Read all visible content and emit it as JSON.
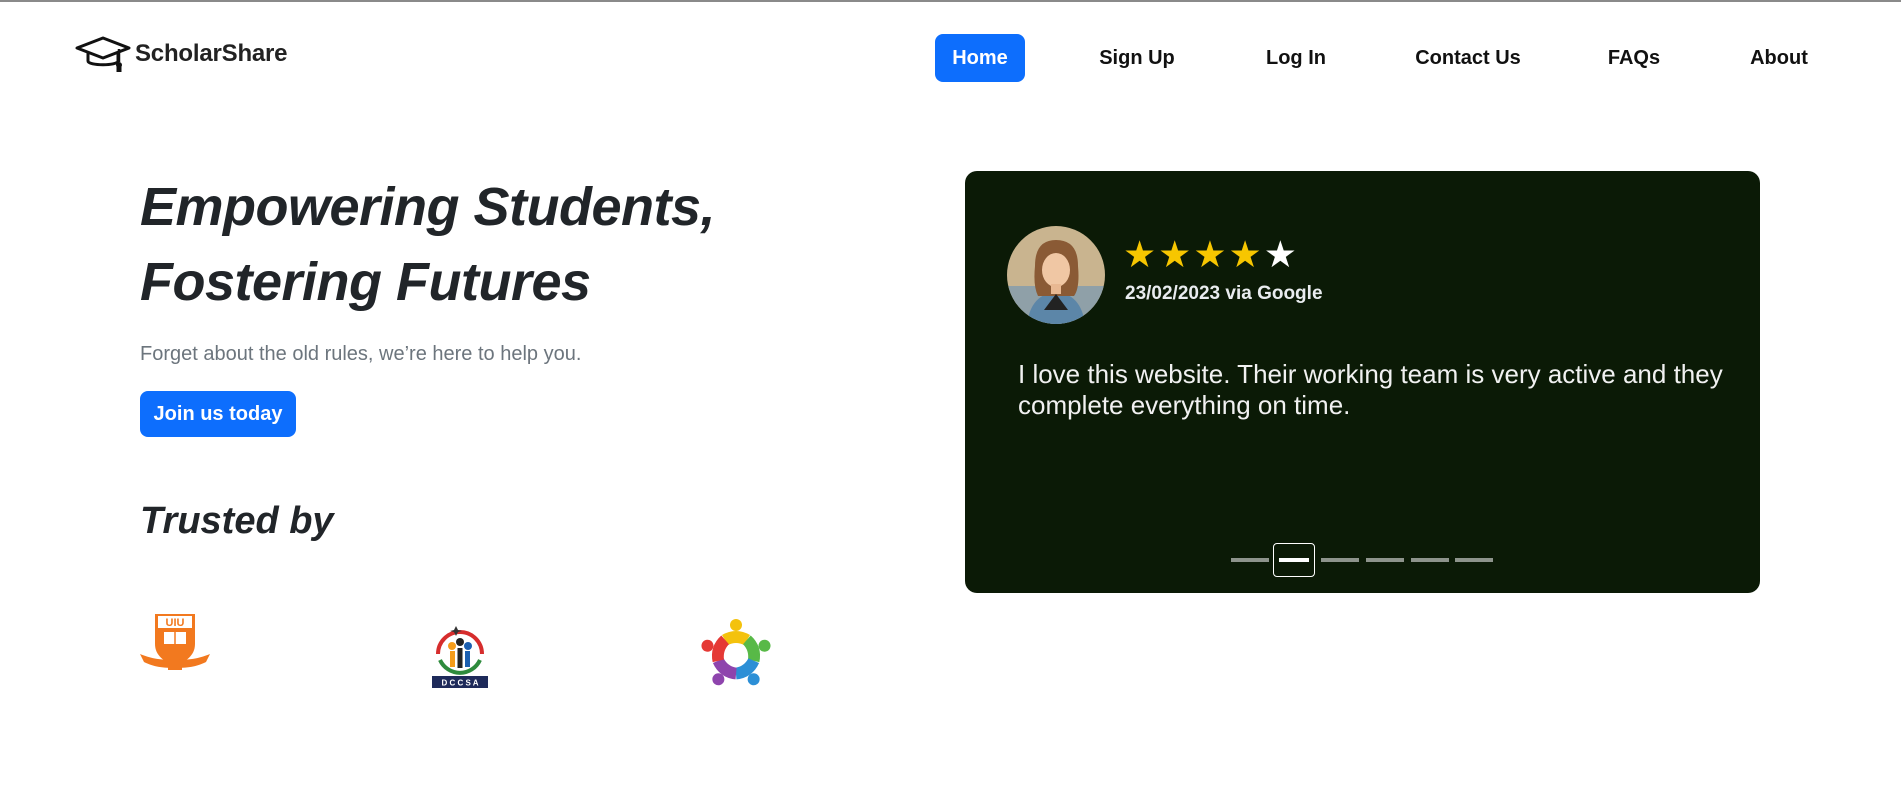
{
  "brand": {
    "name": "ScholarShare",
    "icon": "graduation-cap-icon"
  },
  "nav": {
    "items": [
      {
        "label": "Home",
        "active": true
      },
      {
        "label": "Sign Up",
        "active": false
      },
      {
        "label": "Log In",
        "active": false
      },
      {
        "label": "Contact Us",
        "active": false
      },
      {
        "label": "FAQs",
        "active": false
      },
      {
        "label": "About",
        "active": false
      }
    ]
  },
  "hero": {
    "title_line1": "Empowering Students,",
    "title_line2": "Fostering Futures",
    "subtitle": "Forget about the old rules, we’re here to help you.",
    "cta_label": "Join us today"
  },
  "trusted": {
    "heading": "Trusted by",
    "logos": [
      {
        "name": "uiu-logo",
        "text": "UIU"
      },
      {
        "name": "dccsa-logo",
        "text": "D C C S A"
      },
      {
        "name": "community-circle-logo"
      }
    ]
  },
  "review": {
    "rating": 4,
    "rating_max": 5,
    "date_source": "23/02/2023 via Google",
    "text": "I love this website. Their working team is very active and they complete everything on time.",
    "slides_total": 6,
    "active_slide": 2
  },
  "colors": {
    "accent": "#0d6efd",
    "card_bg": "#0b1a06",
    "star": "#f7c600",
    "muted_text": "#6c757d"
  }
}
